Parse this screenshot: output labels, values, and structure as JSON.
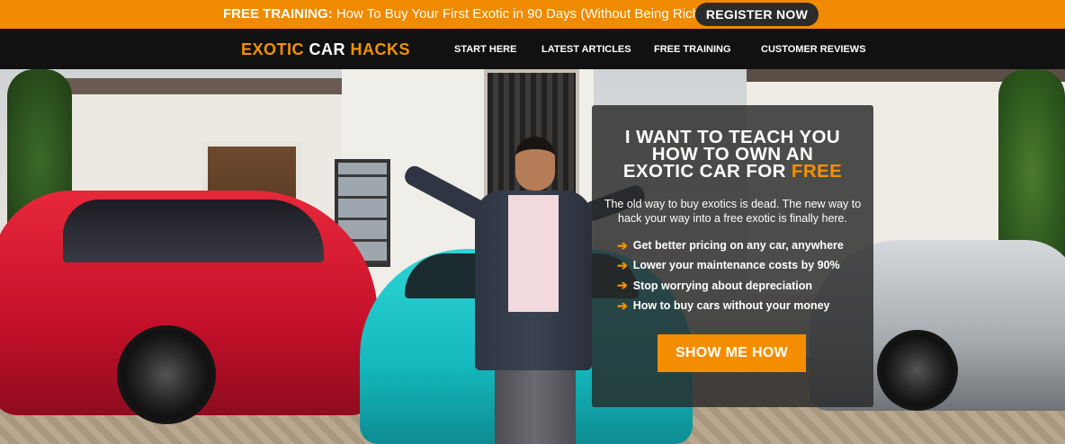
{
  "promo": {
    "label_bold": "FREE TRAINING:",
    "label_text": " How To Buy Your First Exotic in 90 Days (Without Being Rich)",
    "register_label": "REGISTER NOW"
  },
  "nav": {
    "logo_part1": "EXOTIC ",
    "logo_part2": "CAR ",
    "logo_part3": "HACKS",
    "items": [
      {
        "label": "START HERE"
      },
      {
        "label": "LATEST ARTICLES"
      },
      {
        "label": "FREE TRAINING"
      },
      {
        "label": "CUSTOMER REVIEWS"
      }
    ]
  },
  "hero": {
    "headline_line1": "I WANT TO TEACH YOU",
    "headline_line2": "HOW TO OWN AN",
    "headline_line3_pre": "EXOTIC CAR FOR ",
    "headline_line3_accent": "FREE",
    "subtext": "The old way to buy exotics is dead. The new way to hack your way into a free exotic is finally here.",
    "bullets": [
      {
        "arrow": "➔",
        "text": "Get better pricing on any car, anywhere"
      },
      {
        "arrow": "➔",
        "text": "Lower your maintenance costs by 90%"
      },
      {
        "arrow": "➔",
        "text": "Stop worrying about depreciation"
      },
      {
        "arrow": "➔",
        "text": "How to buy cars without your money"
      }
    ],
    "cta_label": "SHOW ME HOW"
  },
  "colors": {
    "accent": "#f39200",
    "promo_bar": "#f08a00",
    "nav_bg": "#111111"
  }
}
